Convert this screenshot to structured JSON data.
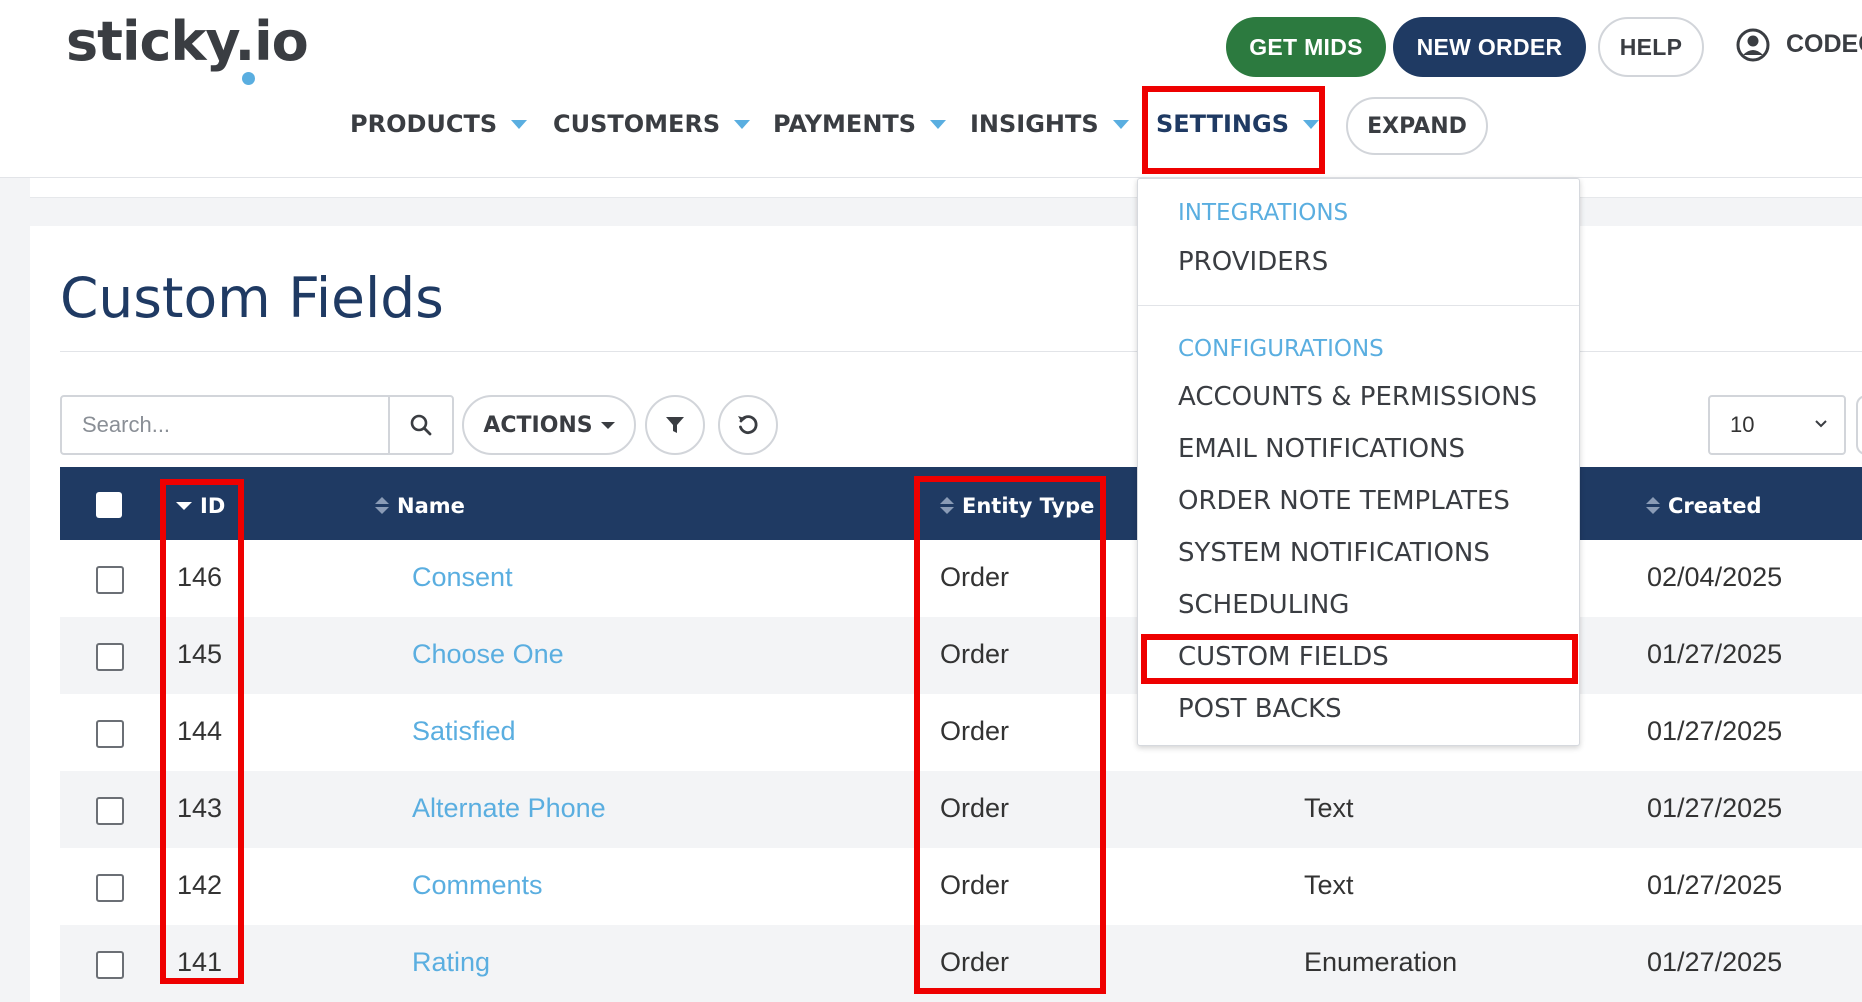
{
  "header": {
    "logo": "sticky.io",
    "get_mids": "GET MIDS",
    "new_order": "NEW ORDER",
    "help": "HELP",
    "user_name": "CODEC"
  },
  "nav": {
    "products": "PRODUCTS",
    "customers": "CUSTOMERS",
    "payments": "PAYMENTS",
    "insights": "INSIGHTS",
    "settings": "SETTINGS",
    "expand": "EXPAND"
  },
  "page": {
    "title": "Custom Fields"
  },
  "toolbar": {
    "search_placeholder": "Search...",
    "actions": "ACTIONS",
    "per_page": "10"
  },
  "table": {
    "headers": {
      "id": "ID",
      "name": "Name",
      "entity_type": "Entity Type",
      "created": "Created"
    },
    "rows": [
      {
        "id": "146",
        "name": "Consent",
        "entity": "Order",
        "type": "",
        "created": "02/04/2025"
      },
      {
        "id": "145",
        "name": "Choose One",
        "entity": "Order",
        "type": "",
        "created": "01/27/2025"
      },
      {
        "id": "144",
        "name": "Satisfied",
        "entity": "Order",
        "type": "",
        "created": "01/27/2025"
      },
      {
        "id": "143",
        "name": "Alternate Phone",
        "entity": "Order",
        "type": "Text",
        "created": "01/27/2025"
      },
      {
        "id": "142",
        "name": "Comments",
        "entity": "Order",
        "type": "Text",
        "created": "01/27/2025"
      },
      {
        "id": "141",
        "name": "Rating",
        "entity": "Order",
        "type": "Enumeration",
        "created": "01/27/2025"
      }
    ]
  },
  "settings_menu": {
    "group_integrations": "INTEGRATIONS",
    "providers": "PROVIDERS",
    "group_configurations": "CONFIGURATIONS",
    "accounts_permissions": "ACCOUNTS & PERMISSIONS",
    "email_notifications": "EMAIL NOTIFICATIONS",
    "order_note_templates": "ORDER NOTE TEMPLATES",
    "system_notifications": "SYSTEM NOTIFICATIONS",
    "scheduling": "SCHEDULING",
    "custom_fields": "CUSTOM FIELDS",
    "post_backs": "POST BACKS"
  },
  "colors": {
    "navy": "#1f3a63",
    "green": "#2c7a3f",
    "link_blue": "#5aaee0",
    "annotation_red": "#ee0000"
  },
  "icons": {
    "search": "search-icon",
    "filter": "filter-icon",
    "refresh": "refresh-icon",
    "user": "user-circle-icon"
  }
}
